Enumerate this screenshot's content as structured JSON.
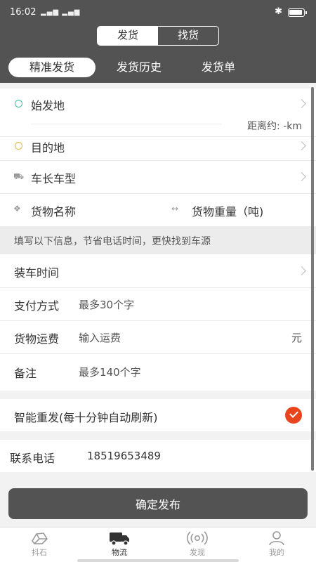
{
  "status_bar": {
    "time": "16:02",
    "signal": "▂▄▆ ▂▄▆",
    "bluetooth": "✱"
  },
  "segment": {
    "left": "发货",
    "right": "找货"
  },
  "tabs": [
    {
      "label": "精准发货"
    },
    {
      "label": "发货历史"
    },
    {
      "label": "发货单"
    }
  ],
  "form": {
    "origin_label": "始发地",
    "distance_text": "距离约: -km",
    "destination_label": "目的地",
    "vehicle_label": "车长车型",
    "cargo_name_label": "货物名称",
    "cargo_weight_label": "货物重量（吨)",
    "hint_text": "填写以下信息，节省电话时间，更快找到车源",
    "load_time_label": "装车时间",
    "payment_label": "支付方式",
    "payment_placeholder": "最多30个字",
    "freight_label": "货物运费",
    "freight_placeholder": "输入运费",
    "freight_unit": "元",
    "remark_label": "备注",
    "remark_placeholder": "最多140个字",
    "smart_repost_label": "智能重发(每十分钟自动刷新)",
    "contact_label": "联系电话",
    "contact_value": "18519653489"
  },
  "submit_label": "确定发布",
  "bottom_nav": [
    {
      "label": "抖石"
    },
    {
      "label": "物流"
    },
    {
      "label": "发现"
    },
    {
      "label": "我的"
    }
  ],
  "colors": {
    "header": "#535353",
    "accent": "#e8441e",
    "origin_dot": "#3dbf9a",
    "destination_dot": "#e8b84a"
  }
}
